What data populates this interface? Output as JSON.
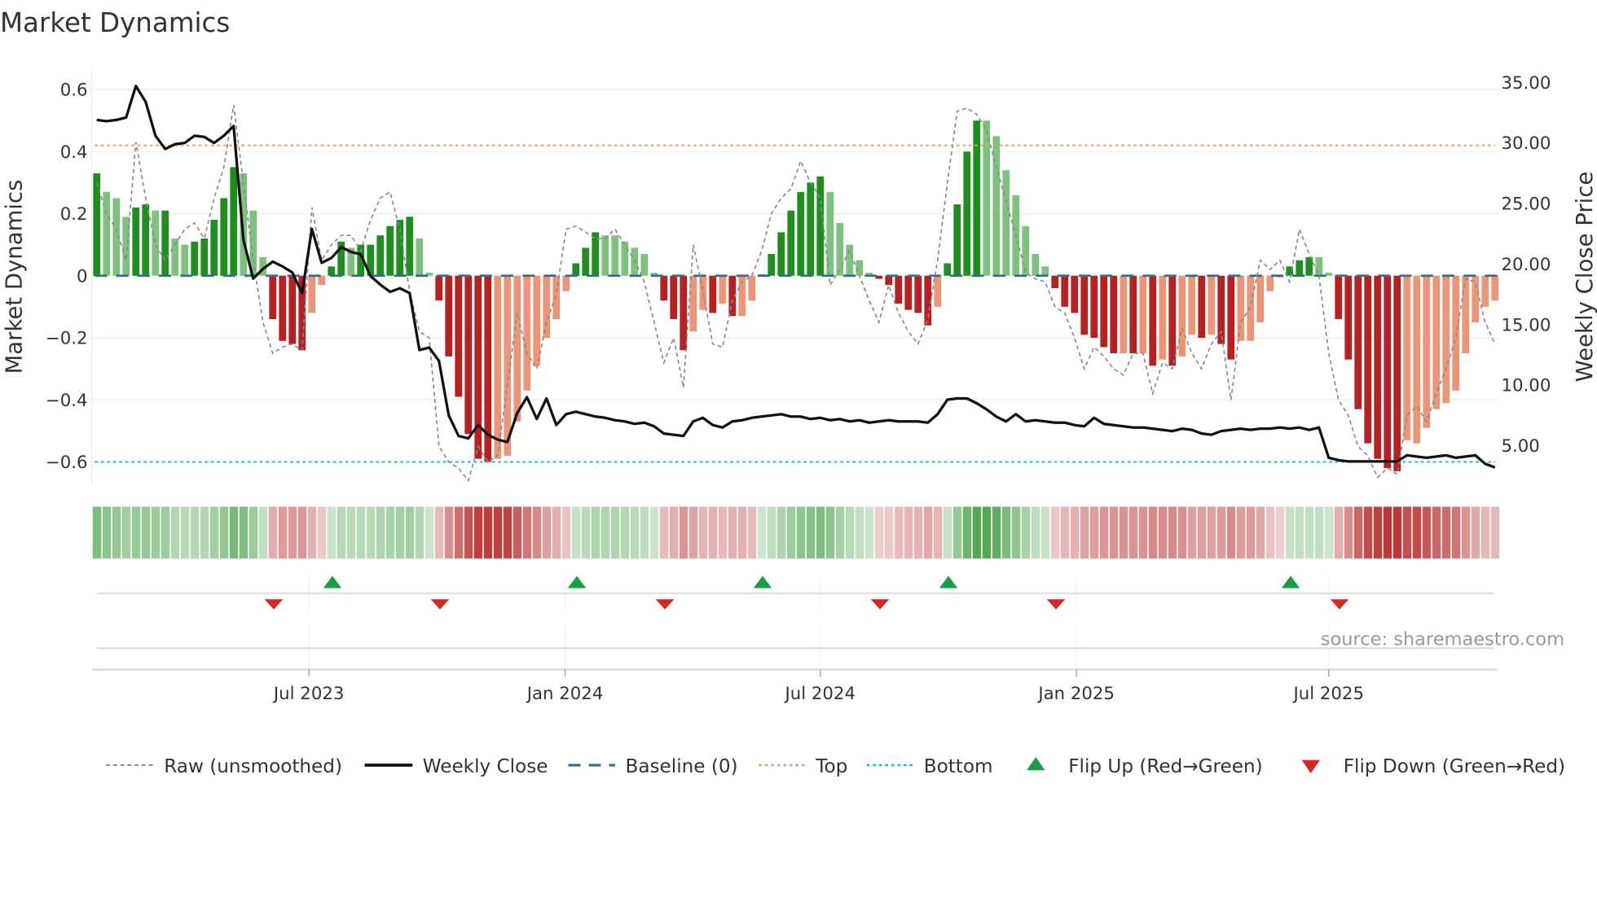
{
  "chart_data": {
    "type": "bar",
    "title": "Market Dynamics",
    "ylabel": "Market Dynamics",
    "y2label": "Weekly Close Price",
    "ylim": [
      -0.68,
      0.68
    ],
    "y2lim": [
      1.6,
      37.3
    ],
    "yticks": [
      "0.6",
      "0.4",
      "0.2",
      "0",
      "−0.2",
      "−0.4",
      "−0.6"
    ],
    "ytick_values": [
      0.6,
      0.4,
      0.2,
      0,
      -0.2,
      -0.4,
      -0.6
    ],
    "y2ticks": [
      "35.00",
      "30.00",
      "25.00",
      "20.00",
      "15.00",
      "10.00",
      "5.00"
    ],
    "y2tick_values": [
      35,
      30,
      25,
      20,
      15,
      10,
      5
    ],
    "xticks": [
      {
        "label": "Jul 2023",
        "week": 21.7
      },
      {
        "label": "Jan 2024",
        "week": 47.9
      },
      {
        "label": "Jul 2024",
        "week": 74.0
      },
      {
        "label": "Jan 2025",
        "week": 100.2
      },
      {
        "label": "Jul 2025",
        "week": 126.0
      }
    ],
    "top_level": 0.42,
    "bottom_level": -0.6,
    "baseline": 0,
    "grid": true,
    "legend_placement": "bottom",
    "colors": {
      "green_strong": "#228b22",
      "green_weak": "#80c080",
      "red_strong": "#b22222",
      "red_weak": "#e9967a",
      "baseline": "#2b6f9e",
      "top": "#e8a060",
      "bottom": "#17becf",
      "close": "#111111",
      "raw": "#888888",
      "flip_up": "#1a9e45",
      "flip_down": "#d62728"
    },
    "smoothed": [
      0.33,
      0.27,
      0.25,
      0.19,
      0.22,
      0.23,
      0.21,
      0.21,
      0.12,
      0.1,
      0.11,
      0.12,
      0.18,
      0.25,
      0.35,
      0.33,
      0.21,
      0.06,
      -0.14,
      -0.21,
      -0.22,
      -0.24,
      -0.12,
      -0.03,
      0.03,
      0.11,
      0.09,
      0.1,
      0.1,
      0.13,
      0.16,
      0.18,
      0.19,
      0.12,
      0.01,
      -0.08,
      -0.26,
      -0.39,
      -0.51,
      -0.59,
      -0.6,
      -0.59,
      -0.58,
      -0.47,
      -0.37,
      -0.29,
      -0.2,
      -0.14,
      -0.05,
      0.04,
      0.09,
      0.14,
      0.13,
      0.13,
      0.11,
      0.09,
      0.07,
      0.01,
      -0.08,
      -0.14,
      -0.24,
      -0.18,
      -0.11,
      -0.12,
      -0.09,
      -0.13,
      -0.13,
      -0.08,
      0.005,
      0.07,
      0.14,
      0.21,
      0.27,
      0.3,
      0.32,
      0.27,
      0.17,
      0.1,
      0.05,
      0.01,
      -0.01,
      -0.03,
      -0.09,
      -0.11,
      -0.12,
      -0.16,
      -0.1,
      0.04,
      0.23,
      0.4,
      0.5,
      0.5,
      0.45,
      0.34,
      0.26,
      0.16,
      0.07,
      0.03,
      -0.04,
      -0.1,
      -0.12,
      -0.19,
      -0.2,
      -0.23,
      -0.25,
      -0.25,
      -0.25,
      -0.25,
      -0.29,
      -0.27,
      -0.29,
      -0.26,
      -0.19,
      -0.2,
      -0.19,
      -0.22,
      -0.27,
      -0.21,
      -0.21,
      -0.15,
      -0.05,
      -0.005,
      0.03,
      0.05,
      0.06,
      0.06,
      0.01,
      -0.14,
      -0.27,
      -0.43,
      -0.54,
      -0.59,
      -0.62,
      -0.63,
      -0.53,
      -0.54,
      -0.49,
      -0.43,
      -0.41,
      -0.37,
      -0.25,
      -0.15,
      -0.1,
      -0.08
    ],
    "strong": [
      1,
      0,
      0,
      0,
      1,
      1,
      0,
      1,
      0,
      0,
      1,
      1,
      1,
      1,
      1,
      0,
      0,
      0,
      1,
      1,
      1,
      1,
      0,
      0,
      1,
      1,
      0,
      1,
      1,
      1,
      1,
      1,
      1,
      0,
      0,
      1,
      1,
      1,
      1,
      1,
      1,
      0,
      0,
      0,
      0,
      0,
      0,
      0,
      0,
      1,
      1,
      1,
      0,
      0,
      0,
      0,
      0,
      0,
      1,
      1,
      1,
      0,
      0,
      1,
      0,
      1,
      0,
      0,
      0,
      1,
      1,
      1,
      1,
      1,
      1,
      0,
      0,
      0,
      0,
      0,
      1,
      1,
      1,
      1,
      1,
      1,
      0,
      1,
      1,
      1,
      1,
      0,
      0,
      0,
      0,
      0,
      0,
      0,
      1,
      1,
      1,
      1,
      1,
      1,
      1,
      0,
      1,
      0,
      1,
      0,
      1,
      0,
      0,
      1,
      0,
      1,
      1,
      0,
      0,
      0,
      0,
      0,
      1,
      1,
      1,
      0,
      0,
      1,
      1,
      1,
      1,
      1,
      1,
      1,
      0,
      0,
      0,
      0,
      0,
      0,
      0,
      0,
      0,
      0
    ],
    "raw": [
      0.3,
      0.2,
      0.15,
      0.05,
      0.43,
      0.25,
      0.1,
      0.05,
      0.1,
      0.15,
      0.17,
      0.12,
      0.25,
      0.35,
      0.55,
      0.3,
      0.05,
      -0.15,
      -0.25,
      -0.23,
      -0.22,
      -0.24,
      0.22,
      0.05,
      0.1,
      0.13,
      0.13,
      0.08,
      0.18,
      0.25,
      0.27,
      0.15,
      -0.05,
      -0.18,
      -0.2,
      -0.55,
      -0.6,
      -0.62,
      -0.66,
      -0.55,
      -0.6,
      -0.58,
      -0.35,
      -0.12,
      -0.25,
      -0.3,
      -0.15,
      -0.06,
      0.15,
      0.16,
      0.14,
      0.12,
      0.12,
      0.15,
      0.1,
      0.05,
      -0.02,
      -0.15,
      -0.28,
      -0.2,
      -0.36,
      0.1,
      -0.05,
      -0.22,
      -0.23,
      -0.08,
      -0.02,
      0.0,
      0.08,
      0.2,
      0.25,
      0.28,
      0.37,
      0.3,
      0.25,
      -0.03,
      0.02,
      0.08,
      0.0,
      -0.08,
      -0.15,
      -0.03,
      -0.12,
      -0.18,
      -0.22,
      -0.14,
      0.05,
      0.3,
      0.53,
      0.54,
      0.52,
      0.47,
      0.35,
      0.24,
      0.13,
      0.01,
      -0.01,
      -0.02,
      -0.1,
      -0.12,
      -0.2,
      -0.3,
      -0.23,
      -0.26,
      -0.3,
      -0.32,
      -0.25,
      -0.25,
      -0.38,
      -0.28,
      -0.3,
      -0.17,
      -0.25,
      -0.3,
      -0.22,
      -0.18,
      -0.4,
      -0.15,
      -0.1,
      0.05,
      0.02,
      0.05,
      -0.02,
      0.15,
      0.07,
      0.0,
      -0.25,
      -0.4,
      -0.45,
      -0.55,
      -0.58,
      -0.65,
      -0.62,
      -0.64,
      -0.45,
      -0.42,
      -0.47,
      -0.38,
      -0.3,
      -0.2,
      -0.01,
      -0.02,
      -0.15,
      -0.22
    ],
    "close": [
      31.9,
      31.8,
      31.9,
      32.1,
      34.7,
      33.4,
      30.6,
      29.5,
      29.9,
      30.0,
      30.6,
      30.5,
      30.0,
      30.6,
      31.4,
      22.0,
      18.8,
      19.6,
      20.2,
      19.8,
      19.3,
      17.6,
      22.9,
      20.1,
      20.5,
      21.4,
      21.0,
      20.8,
      19.0,
      18.3,
      17.7,
      18.0,
      17.6,
      12.9,
      13.1,
      12.0,
      7.5,
      5.8,
      5.6,
      6.7,
      5.9,
      5.5,
      5.3,
      7.7,
      9.0,
      7.2,
      8.9,
      6.7,
      7.6,
      7.8,
      7.6,
      7.4,
      7.3,
      7.1,
      7.0,
      6.8,
      6.9,
      6.6,
      6.0,
      5.9,
      5.8,
      7.0,
      7.3,
      6.7,
      6.5,
      7.0,
      7.1,
      7.3,
      7.4,
      7.5,
      7.6,
      7.4,
      7.4,
      7.2,
      7.3,
      7.1,
      7.2,
      7.0,
      7.1,
      6.9,
      7.0,
      7.1,
      7.0,
      7.0,
      7.0,
      6.9,
      7.6,
      8.8,
      8.9,
      8.9,
      8.5,
      8.0,
      7.4,
      7.0,
      7.6,
      7.0,
      7.1,
      7.0,
      6.9,
      6.9,
      6.7,
      6.6,
      7.3,
      6.8,
      6.7,
      6.6,
      6.5,
      6.5,
      6.4,
      6.3,
      6.2,
      6.4,
      6.3,
      6.0,
      5.9,
      6.2,
      6.3,
      6.4,
      6.3,
      6.4,
      6.4,
      6.5,
      6.4,
      6.5,
      6.3,
      6.5,
      4.0,
      3.8,
      3.7,
      3.7,
      3.7,
      3.7,
      3.7,
      3.7,
      4.2,
      4.1,
      4.0,
      4.1,
      4.2,
      4.0,
      4.1,
      4.2,
      3.5,
      3.2
    ],
    "flip_up_weeks": [
      24,
      49,
      68,
      87,
      122
    ],
    "flip_down_weeks": [
      18,
      35,
      58,
      80,
      98,
      127
    ],
    "legend": {
      "raw": "Raw (unsmoothed)",
      "close": "Weekly Close",
      "baseline": "Baseline (0)",
      "top": "Top",
      "bottom": "Bottom",
      "flip_up": "Flip Up (Red→Green)",
      "flip_down": "Flip Down (Green→Red)"
    },
    "source": "source: sharemaestro.com"
  }
}
